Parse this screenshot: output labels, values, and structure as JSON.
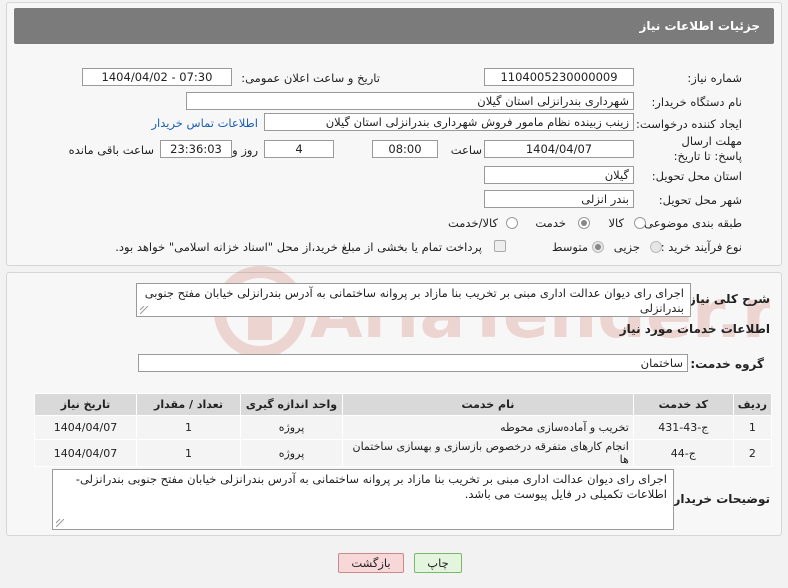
{
  "header": {
    "title": "جزئیات اطلاعات نیاز"
  },
  "fields": {
    "need_number": {
      "label": "شماره نیاز:",
      "value": "1104005230000009"
    },
    "announce_datetime": {
      "label": "تاریخ و ساعت اعلان عمومی:",
      "value": "1404/04/02 - 07:30"
    },
    "buyer_org": {
      "label": "نام دستگاه خریدار:",
      "value": "شهرداری بندرانزلی استان گیلان"
    },
    "requester": {
      "label": "ایجاد کننده درخواست:",
      "value": "زینب زبینده نظام مامور فروش شهرداری بندرانزلی استان گیلان",
      "contact_link": "اطلاعات تماس خریدار"
    },
    "deadline": {
      "label": "مهلت ارسال پاسخ: تا تاریخ:",
      "date": "1404/04/07",
      "time_label": "ساعت",
      "time": "08:00",
      "days": "4",
      "days_label": "روز و",
      "remaining": "23:36:03",
      "remaining_label": "ساعت باقی مانده"
    },
    "delivery_province": {
      "label": "استان محل تحویل:",
      "value": "گیلان"
    },
    "delivery_city": {
      "label": "شهر محل تحویل:",
      "value": "بندر انزلی"
    },
    "category": {
      "label": "طبقه بندی موضوعی:",
      "options": [
        "کالا",
        "خدمت",
        "کالا/خدمت"
      ],
      "selected": "خدمت"
    },
    "purchase_type": {
      "label": "نوع فرآیند خرید :",
      "options": [
        "جزیی",
        "متوسط"
      ],
      "selected": "متوسط",
      "payment_note": "پرداخت تمام یا بخشی از مبلغ خرید،از محل \"اسناد خزانه اسلامی\" خواهد بود."
    }
  },
  "description": {
    "label": "شرح کلی نیاز:",
    "value": "اجرای رای دیوان عدالت اداری مبنی بر تخریب بنا مازاد بر پروانه ساختمانی به آدرس بندرانزلی خیابان مفتح جنوبی بندرانزلی"
  },
  "services": {
    "section_title": "اطلاعات خدمات مورد نیاز",
    "group_label": "گروه خدمت:",
    "group_value": "ساختمان",
    "columns": [
      "ردیف",
      "کد خدمت",
      "نام خدمت",
      "واحد اندازه گیری",
      "تعداد / مقدار",
      "تاریخ نیاز"
    ],
    "rows": [
      [
        "1",
        "ج-43-431",
        "تخریب و آماده‌سازی محوطه",
        "پروژه",
        "1",
        "1404/04/07"
      ],
      [
        "2",
        "ج-44",
        "انجام کارهای متفرقه درخصوص بازسازی و بهسازی ساختمان ها",
        "پروژه",
        "1",
        "1404/04/07"
      ]
    ]
  },
  "buyer_notes": {
    "label": "توضیحات خریدار:",
    "value": "اجرای رای دیوان عدالت اداری مبنی بر تخریب بنا مازاد بر پروانه ساختمانی به آدرس بندرانزلی خیابان مفتح جنوبی بندرانزلی- اطلاعات تکمیلی در فایل پیوست می باشد."
  },
  "buttons": {
    "print": "چاپ",
    "back": "بازگشت"
  },
  "watermark": {
    "text": "AriaTender.neT"
  },
  "colors": {
    "header_bg": "#7b7b7b",
    "link": "#1a5fb4",
    "back_button": "#f7d7d7",
    "print_button": "#e3f5dc",
    "watermark": "#c0392b"
  }
}
